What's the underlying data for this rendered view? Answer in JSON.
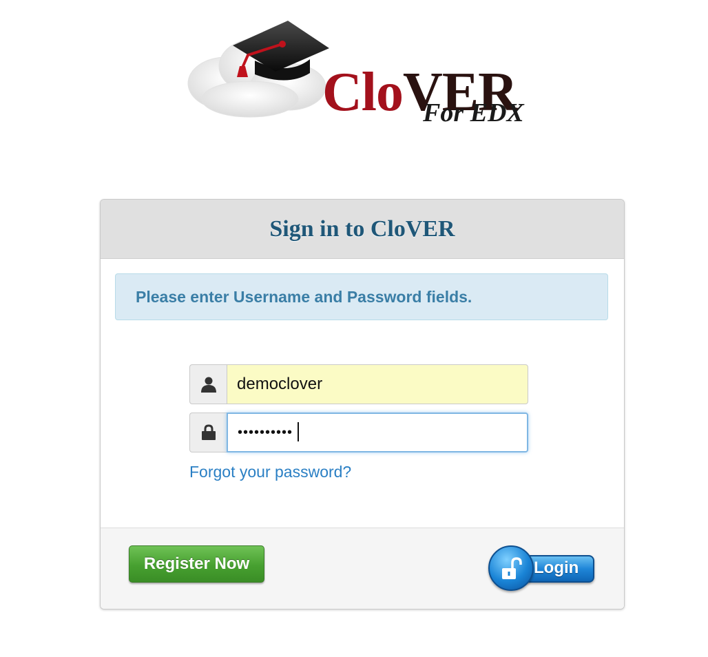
{
  "logo": {
    "title_part1": "Clo",
    "title_part2": "VER",
    "subtitle": "For EDX",
    "icon": "graduation-cap-cloud-logo"
  },
  "panel": {
    "title": "Sign in to CloVER",
    "alert_message": "Please enter Username and Password fields.",
    "username": {
      "value": "democlover",
      "icon": "user-icon"
    },
    "password": {
      "masked_value": "••••••••••",
      "icon": "lock-icon"
    },
    "forgot_link": "Forgot your password?",
    "register_button": "Register Now",
    "login_button": "Login",
    "login_icon": "unlocked-padlock-icon"
  },
  "colors": {
    "title_blue": "#1f5778",
    "alert_bg": "#daeaf4",
    "alert_text": "#3a7ea6",
    "link": "#2a7fc4",
    "register_green": "#47a030",
    "login_blue": "#1f86d8",
    "brand_red": "#a3111c"
  }
}
